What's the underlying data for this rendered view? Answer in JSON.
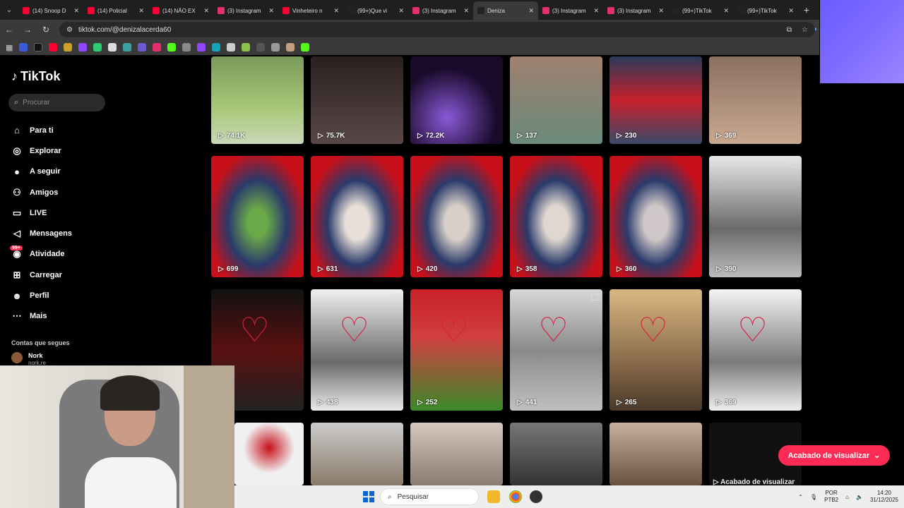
{
  "browser": {
    "tabs": [
      {
        "title": "(14) Snoop D",
        "color": "#ff0033"
      },
      {
        "title": "(14) Policial",
        "color": "#ff0033"
      },
      {
        "title": "(14) NÃO EX",
        "color": "#ff0033"
      },
      {
        "title": "(3) Instagram",
        "color": "#e1306c"
      },
      {
        "title": "Vinheteiro n",
        "color": "#ff0033"
      },
      {
        "title": "(99+)Que vi",
        "color": "#222222"
      },
      {
        "title": "(3) Instagram",
        "color": "#e1306c"
      },
      {
        "title": "Deniza",
        "color": "#222222",
        "active": true
      },
      {
        "title": "(3) Instagram",
        "color": "#e1306c"
      },
      {
        "title": "(3) Instagram",
        "color": "#e1306c"
      },
      {
        "title": "(99+)TikTok",
        "color": "#222222"
      },
      {
        "title": "(99+)TikTok",
        "color": "#222222"
      }
    ],
    "url": "tiktok.com/@denizalacerda60"
  },
  "sidebar": {
    "logo": "TikTok",
    "search_placeholder": "Procurar",
    "items": [
      {
        "label": "Para ti",
        "icon": "home-icon"
      },
      {
        "label": "Explorar",
        "icon": "compass-icon"
      },
      {
        "label": "A seguir",
        "icon": "avatar-icon"
      },
      {
        "label": "Amigos",
        "icon": "friends-icon"
      },
      {
        "label": "LIVE",
        "icon": "live-icon"
      },
      {
        "label": "Mensagens",
        "icon": "message-icon"
      },
      {
        "label": "Atividade",
        "icon": "activity-icon",
        "badge": "99+"
      },
      {
        "label": "Carregar",
        "icon": "upload-icon"
      },
      {
        "label": "Perfil",
        "icon": "profile-icon"
      },
      {
        "label": "Mais",
        "icon": "more-icon"
      }
    ],
    "following_header": "Contas que segues",
    "following": [
      {
        "name": "Nork",
        "handle": "nork.re"
      }
    ]
  },
  "videos": {
    "row1": [
      "74.1K",
      "75.7K",
      "72.2K",
      "137",
      "230",
      "369"
    ],
    "row2": [
      "699",
      "631",
      "420",
      "358",
      "360",
      "390"
    ],
    "row3": [
      "29",
      "438",
      "252",
      "441",
      "265",
      "369"
    ]
  },
  "toast": {
    "label": "Acabado de visualizar"
  },
  "toast_overlay": {
    "label": "Acabado de visualizar"
  },
  "taskbar": {
    "search_placeholder": "Pesquisar",
    "lang1": "POR",
    "lang2": "PTB2",
    "time": "14:20",
    "date": "31/12/2025"
  }
}
